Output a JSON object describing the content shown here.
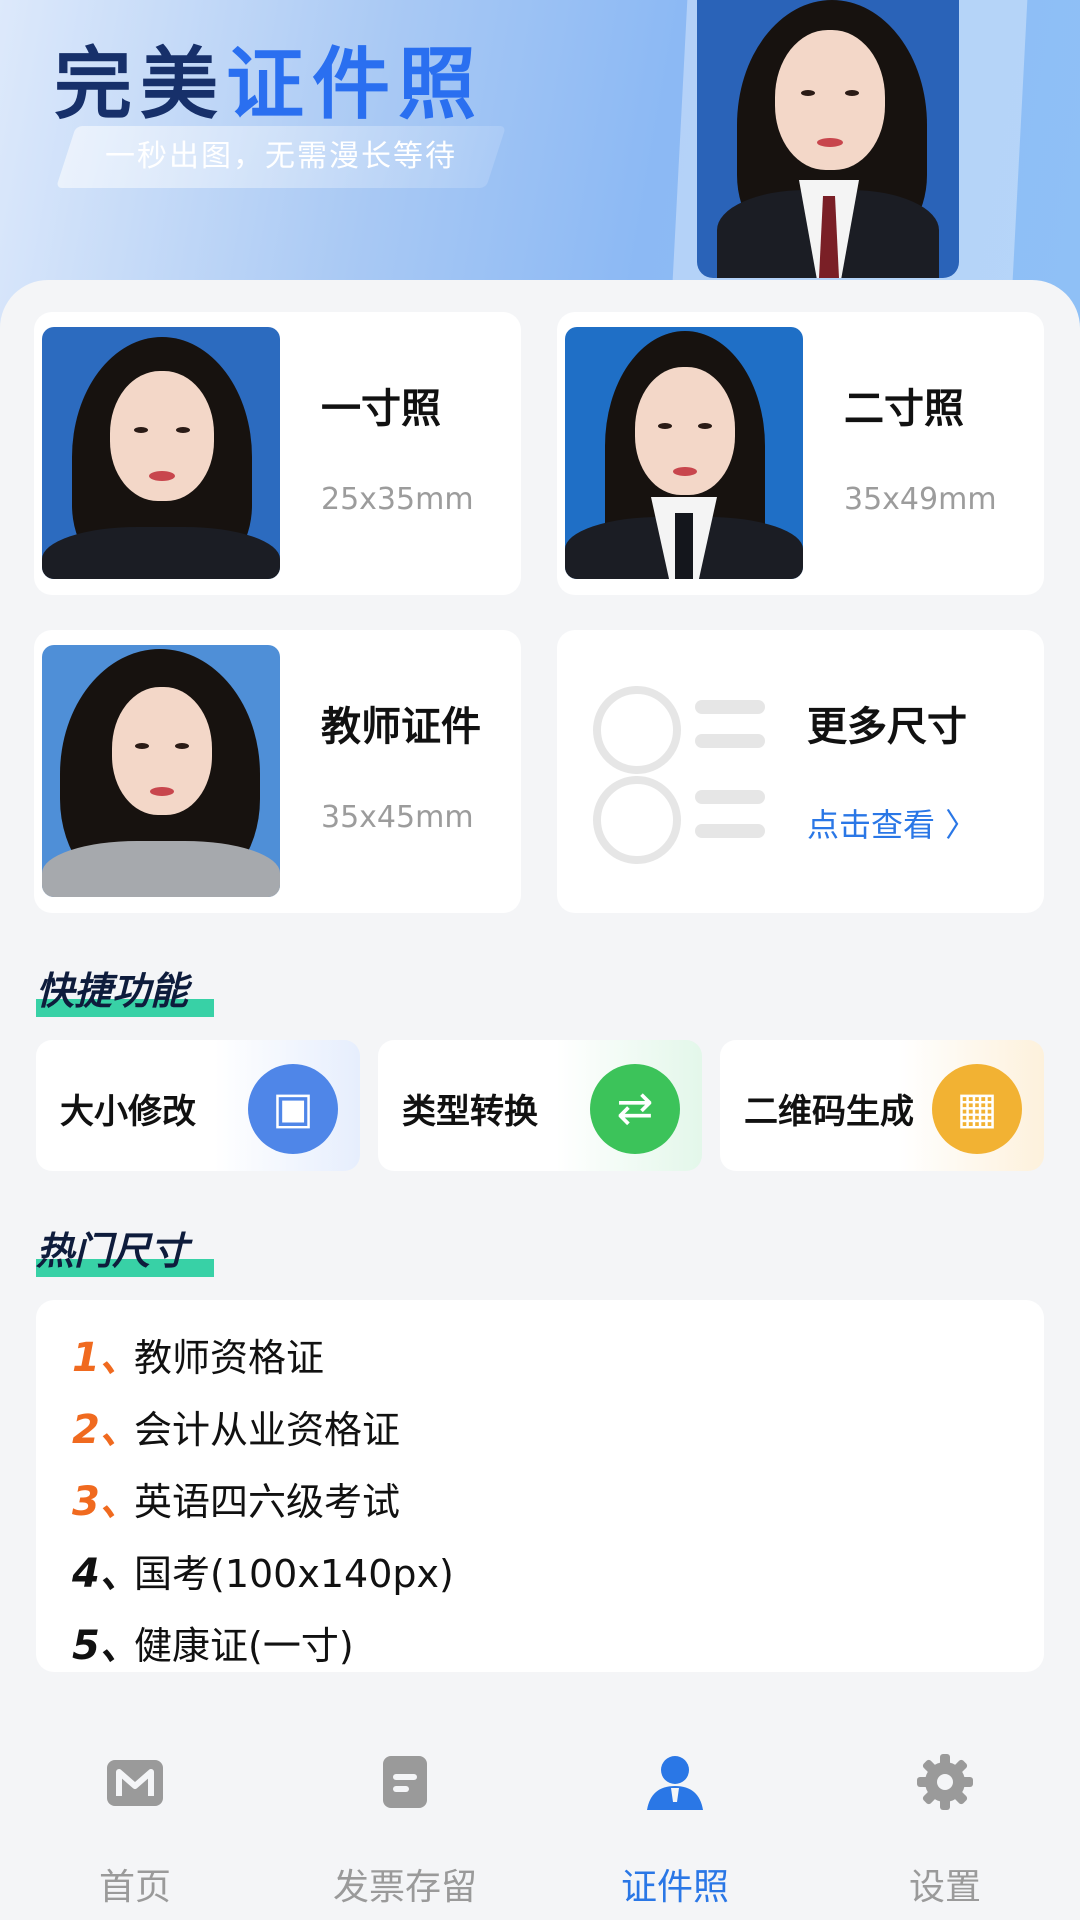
{
  "banner": {
    "title_dark": "完美",
    "title_blue": "证件照",
    "subtitle": "一秒出图，无需漫长等待"
  },
  "sizes": [
    {
      "name": "一寸照",
      "dim": "25x35mm",
      "bg": "#2c6bbf"
    },
    {
      "name": "二寸照",
      "dim": "35x49mm",
      "bg": "#1f6fc6"
    },
    {
      "name": "教师证件",
      "dim": "35x45mm",
      "bg": "#4f8fd7"
    }
  ],
  "more": {
    "name": "更多尺寸",
    "link": "点击查看 〉"
  },
  "quick": {
    "title": "快捷功能",
    "items": [
      {
        "label": "大小修改",
        "icon": "portrait-resize-icon",
        "color": "#4f86e8"
      },
      {
        "label": "类型转换",
        "icon": "convert-icon",
        "color": "#3cc35a"
      },
      {
        "label": "二维码生成",
        "icon": "qr-grid-icon",
        "color": "#f2b233"
      }
    ]
  },
  "hot": {
    "title": "热门尺寸",
    "items": [
      {
        "num": "1、",
        "text": "教师资格证",
        "color": "#f06a1f"
      },
      {
        "num": "2、",
        "text": "会计从业资格证",
        "color": "#f06a1f"
      },
      {
        "num": "3、",
        "text": "英语四六级考试",
        "color": "#f06a1f"
      },
      {
        "num": "4、",
        "text": "国考(100x140px)",
        "color": "#111111"
      },
      {
        "num": "5、",
        "text": "健康证(一寸)",
        "color": "#111111"
      }
    ]
  },
  "tabs": [
    {
      "label": "首页",
      "icon": "home-m-icon"
    },
    {
      "label": "发票存留",
      "icon": "invoice-icon"
    },
    {
      "label": "证件照",
      "icon": "id-photo-person-icon",
      "active": true
    },
    {
      "label": "设置",
      "icon": "gear-icon"
    }
  ],
  "colors": {
    "accent": "#2a77e6",
    "inactive": "#9a9a9a"
  }
}
